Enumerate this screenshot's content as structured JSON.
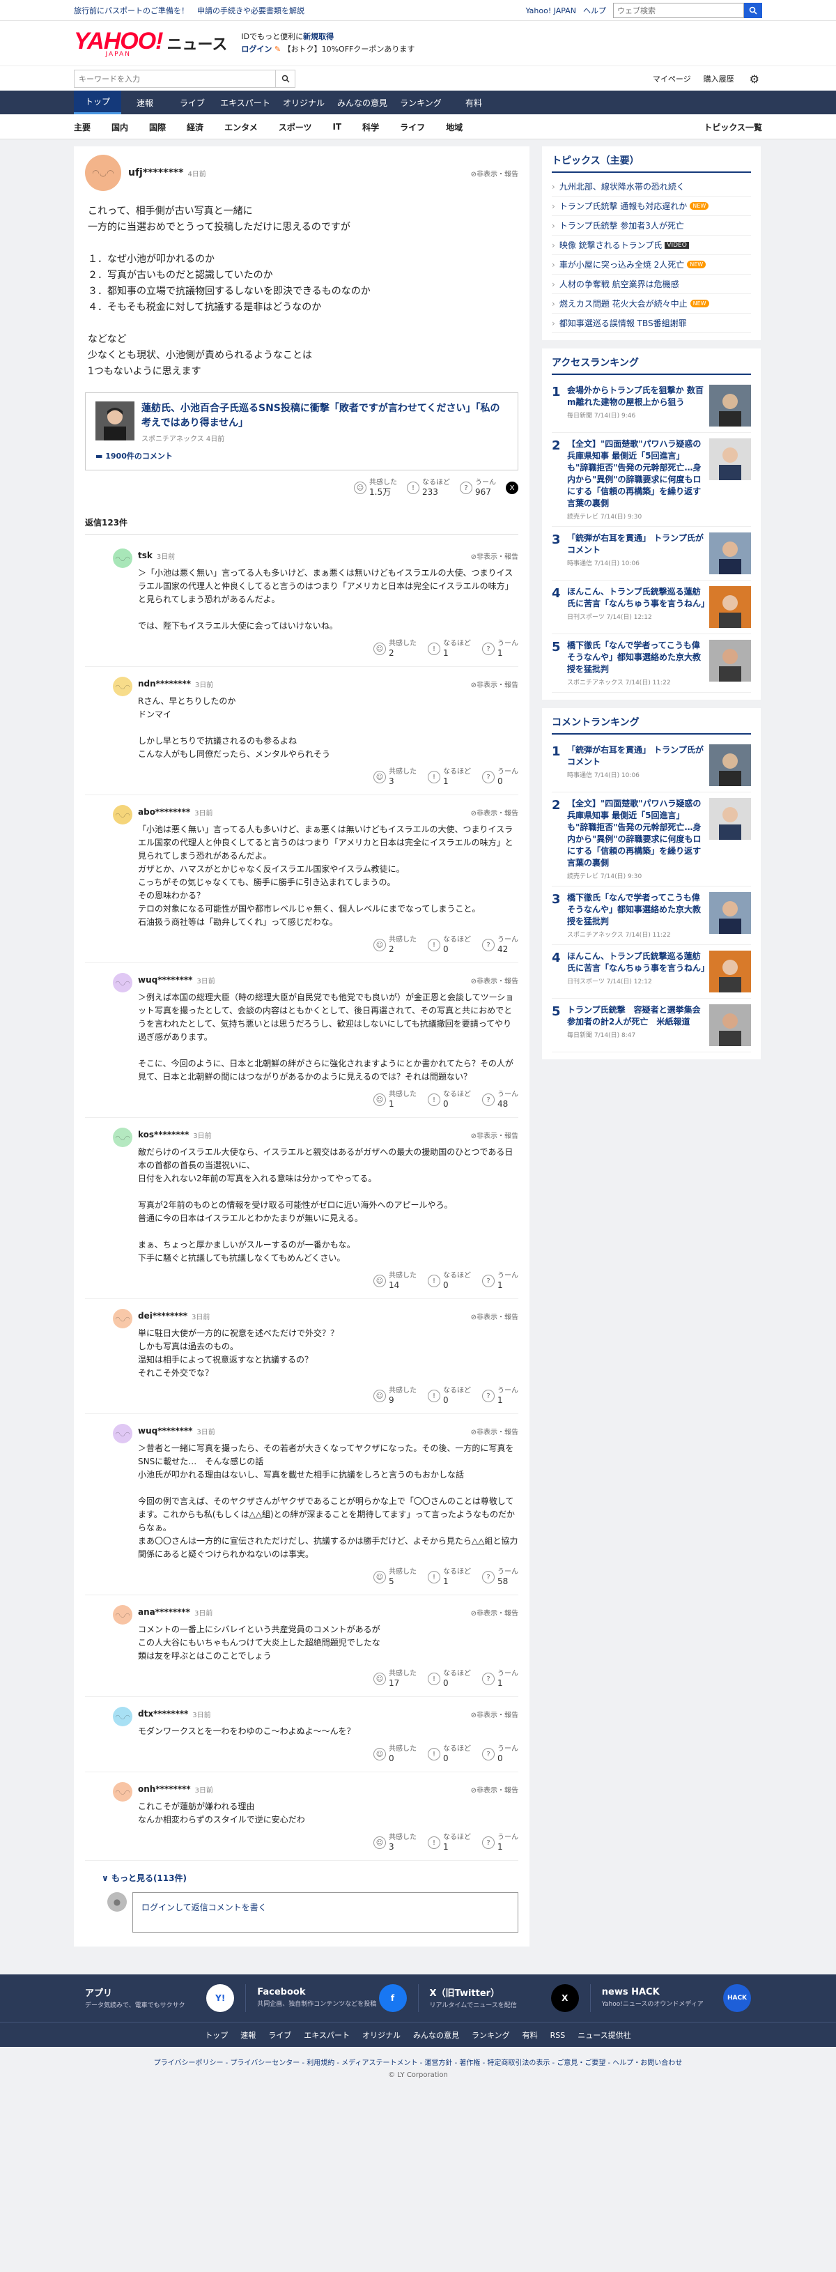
{
  "top_strip": {
    "link1": "旅行前にパスポートのご準備を！",
    "link2": "申請の手続きや必要書類を解説",
    "yahoo_japan": "Yahoo! JAPAN",
    "help": "ヘルプ",
    "search_placeholder": "ウェブ検索"
  },
  "header": {
    "logo": "YAHOO!",
    "logo_sub": "JAPAN",
    "news": "ニュース",
    "promo_line1a": "IDでもっと便利に",
    "promo_line1b": "新規取得",
    "promo_line2a": "ログイン",
    "promo_line2b": "【おトク】10%OFFクーポンあります"
  },
  "search_row": {
    "placeholder": "キーワードを入力",
    "mypage": "マイページ",
    "purchase": "購入履歴"
  },
  "global_nav": [
    "トップ",
    "速報",
    "ライブ",
    "エキスパート",
    "オリジナル",
    "みんなの意見",
    "ランキング",
    "有料"
  ],
  "category_nav": [
    "主要",
    "国内",
    "国際",
    "経済",
    "エンタメ",
    "スポーツ",
    "IT",
    "科学",
    "ライフ",
    "地域"
  ],
  "category_nav_right": "トピックス一覧",
  "original_comment": {
    "user": "ufj********",
    "time": "4日前",
    "report": "非表示・報告",
    "text": "これって、相手側が古い写真と一緒に\n一方的に当選おめでとうって投稿しただけに思えるのですが\n\n１．なぜ小池が叩かれるのか\n２．写真が古いものだと認識していたのか\n３．都知事の立場で抗議物回するしないを即決できるものなのか\n４．そもそも税金に対して抗議する是非はどうなのか\n\nなどなど\n少なくとも現状、小池側が責められるようなことは\n1つもないように思えます",
    "card_title": "蓮舫氏、小池百合子氏巡るSNS投稿に衝撃「敗者ですが言わせてください」「私の考えではあり得ません」",
    "card_source": "スポニチアネックス 4日前",
    "card_count": "1900件のコメント",
    "react_labels": [
      "共感した",
      "なるほど",
      "うーん"
    ],
    "react_values": [
      "1.5万",
      "233",
      "967"
    ]
  },
  "replies_header": "返信123件",
  "replies": [
    {
      "user": "tsk",
      "time": "3日前",
      "text": "＞「小池は悪く無い」言ってる人も多いけど、まぁ悪くは無いけどもイスラエルの大使、つまりイスラエル国家の代理人と仲良くしてると言うのはつまり「アメリカと日本は完全にイスラエルの味方」と見られてしまう恐れがあるんだよ。\n\nでは、陛下もイスラエル大使に会ってはいけないね。",
      "v": [
        "2",
        "1",
        "1"
      ]
    },
    {
      "user": "ndn********",
      "time": "3日前",
      "text": "Rさん、早とちりしたのか\nドンマイ\n\nしかし早とちりで抗議されるのも参るよね\nこんな人がもし同僚だったら、メンタルやられそう",
      "v": [
        "3",
        "1",
        "0"
      ]
    },
    {
      "user": "abo********",
      "time": "3日前",
      "text": "「小池は悪く無い」言ってる人も多いけど、まぁ悪くは無いけどもイスラエルの大使、つまりイスラエル国家の代理人と仲良くしてると言うのはつまり「アメリカと日本は完全にイスラエルの味方」と見られてしまう恐れがあるんだよ。\nガザとか、ハマスがとかじゃなく反イスラエル国家やイスラム教徒に。\nこっちがその気じゃなくても、勝手に勝手に引き込まれてしまうの。\nその恩味わかる？\nテロの対象になる可能性が国や都市レベルじゃ無く、個人レベルにまでなってしまうこと。\n石油扱う商社等は「勘弁してくれ」って感じだわな。",
      "v": [
        "2",
        "0",
        "42"
      ]
    },
    {
      "user": "wuq********",
      "time": "3日前",
      "text": "＞例えば本国の総理大臣（時の総理大臣が自民党でも他党でも良いが）が金正恩と会談してツーショット写真を撮ったとして、会談の内容はともかくとして、後日再選されて、その写真と共におめでとうを言われたとして、気持ち悪いとは思うだろうし、歓迎はしないにしても抗議撤回を要請ってやり過ぎ感があります。\n\nそこに、今回のように、日本と北朝鮮の絆がさらに強化されますようにとか書かれてたら？その人が見て、日本と北朝鮮の間にはつながりがあるかのように見えるのでは？それは問題ない？",
      "v": [
        "1",
        "0",
        "48"
      ]
    },
    {
      "user": "kos********",
      "time": "3日前",
      "text": "敵だらけのイスラエル大使なら、イスラエルと親交はあるがガザへの最大の援助国のひとつである日本の首都の首長の当選祝いに、\n日付を入れない2年前の写真を入れる意味は分かってやってる。\n\n写真が2年前のものとの情報を受け取る可能性がゼロに近い海外へのアピールやろ。\n普通に今の日本はイスラエルとわかたまりが無いに見える。\n\nまぁ、ちょっと厚かましいがスルーするのが一番かもな。\n下手に騒ぐと抗議しても抗議しなくてもめんどくさい。",
      "v": [
        "14",
        "0",
        "1"
      ]
    },
    {
      "user": "dei********",
      "time": "3日前",
      "text": "単に駐日大使が一方的に祝意を述べただけで外交？？\nしかも写真は過去のもの。\n温知は相手によって祝意返すなと抗議するの？\nそれこそ外交でな？",
      "v": [
        "9",
        "0",
        "1"
      ]
    },
    {
      "user": "wuq********",
      "time": "3日前",
      "text": "＞昔者と一緒に写真を撮ったら、その若者が大きくなってヤクザになった。その後、一方的に写真をSNSに載せた…　そんな感じの話\n小池氏が叩かれる理由はないし、写真を載せた相手に抗議をしろと言うのもおかしな話\n\n今回の例で言えば、そのヤクザさんがヤクザであることが明らかな上で「〇〇さんのことは尊敬してます。これからも私(もしくは△△組)との絆が深まることを期待してます」って言ったようなものだからなぁ。\nまあ〇〇さんは一方的に宣伝されただけだし、抗議するかは勝手だけど、よそから見たら△△組と協力関係にあると疑ぐつけられかねないのは事実。",
      "v": [
        "5",
        "1",
        "58"
      ]
    },
    {
      "user": "ana********",
      "time": "3日前",
      "text": "コメントの一番上にシバレイという共産党員のコメントがあるが\nこの人大谷にもいちゃもんつけて大炎上した超絶問題児でしたな\n類は友を呼ぶとはこのことでしょう",
      "v": [
        "17",
        "0",
        "1"
      ]
    },
    {
      "user": "dtx********",
      "time": "3日前",
      "text": "モダンワークスとを一わをわゆのこ〜わよぬよ〜〜んを？",
      "v": [
        "0",
        "0",
        "0"
      ]
    },
    {
      "user": "onh********",
      "time": "3日前",
      "text": "これこそが蓮舫が嫌われる理由\nなんか相変わらずのスタイルで逆に安心だわ",
      "v": [
        "3",
        "1",
        "1"
      ]
    }
  ],
  "more_label": "もっと見る(113件)",
  "reply_input_label": "ログインして返信コメントを書く",
  "topics": {
    "title": "トピックス（主要）",
    "items": [
      {
        "text": "九州北部、線状降水帯の恐れ続く",
        "tag": ""
      },
      {
        "text": "トランプ氏銃撃 通報も対応遅れか",
        "tag": "NEW"
      },
      {
        "text": "トランプ氏銃撃 参加者3人が死亡",
        "tag": ""
      },
      {
        "text": "映像 銃撃されるトランプ氏",
        "tag": "VIDEO"
      },
      {
        "text": "車が小屋に突っ込み全焼 2人死亡",
        "tag": "NEW"
      },
      {
        "text": "人材の争奪戦 航空業界は危機感",
        "tag": ""
      },
      {
        "text": "燃えカス問題 花火大会が続々中止",
        "tag": "NEW"
      },
      {
        "text": "都知事選巡る誤情報 TBS番組謝罪",
        "tag": ""
      }
    ]
  },
  "access_ranking": {
    "title": "アクセスランキング",
    "items": [
      {
        "title": "会場外からトランプ氏を狙撃か 数百m離れた建物の屋根上から狙う",
        "meta": "毎日新聞 7/14(日) 9:46"
      },
      {
        "title": "【全文】\"四面楚歌\"パワハラ疑惑の兵庫県知事 最側近「5回進言」も\"辞職拒否\"告発の元幹部死亡…身内から\"異例\"の辞職要求に何度もロにする「信頼の再構築」を繰り返す言葉の裏側",
        "meta": "読売テレビ 7/14(日) 9:30"
      },
      {
        "title": "「銃弾が右耳を貫通」 トランプ氏がコメント",
        "meta": "時事通信 7/14(日) 10:06"
      },
      {
        "title": "ほんこん、トランプ氏銃撃巡る蓮舫氏に苦言「なんちゅう事を言うねん」",
        "meta": "日刊スポーツ 7/14(日) 12:12"
      },
      {
        "title": "橋下徹氏「なんで学者ってこうも偉そうなんや」都知事選絡めた京大教授を猛批判",
        "meta": "スポニチアネックス 7/14(日) 11:22"
      }
    ]
  },
  "comment_ranking": {
    "title": "コメントランキング",
    "items": [
      {
        "title": "「銃弾が右耳を貫通」 トランプ氏がコメント",
        "meta": "時事通信 7/14(日) 10:06"
      },
      {
        "title": "【全文】\"四面楚歌\"パワハラ疑惑の兵庫県知事 最側近「5回進言」も\"辞職拒否\"告発の元幹部死亡…身内から\"異例\"の辞職要求に何度もロにする「信頼の再構築」を繰り返す言葉の裏側",
        "meta": "読売テレビ 7/14(日) 9:30"
      },
      {
        "title": "橋下徹氏「なんで学者ってこうも偉そうなんや」都知事選絡めた京大教授を猛批判",
        "meta": "スポニチアネックス 7/14(日) 11:22"
      },
      {
        "title": "ほんこん、トランプ氏銃撃巡る蓮舫氏に苦言「なんちゅう事を言うねん」",
        "meta": "日刊スポーツ 7/14(日) 12:12"
      },
      {
        "title": "トランプ氏銃撃　容疑者と選挙集会参加者の計2人が死亡　米紙報道",
        "meta": "毎日新聞 7/14(日) 8:47"
      }
    ]
  },
  "footer": {
    "apps": [
      {
        "title": "アプリ",
        "desc": "データ気読みで、電車でもサクサク",
        "icon": "Y!"
      },
      {
        "title": "Facebook",
        "desc": "共同企画、独自制作コンテンツなどを投稿",
        "icon": "f"
      },
      {
        "title": "X（旧Twitter）",
        "desc": "リアルタイムでニュースを配信",
        "icon": "X"
      },
      {
        "title": "news HACK",
        "desc": "Yahoo!ニュースのオウンドメディア",
        "icon": "HACK"
      }
    ],
    "nav": [
      "トップ",
      "速報",
      "ライブ",
      "エキスパート",
      "オリジナル",
      "みんなの意見",
      "ランキング",
      "有料",
      "RSS",
      "ニュース提供社"
    ],
    "legal": "プライバシーポリシー - プライバシーセンター - 利用規約 - メディアステートメント - 運営方針 - 著作権 - 特定商取引法の表示 - ご意見・ご要望 - ヘルプ・お問い合わせ",
    "copyright": "© LY Corporation"
  }
}
